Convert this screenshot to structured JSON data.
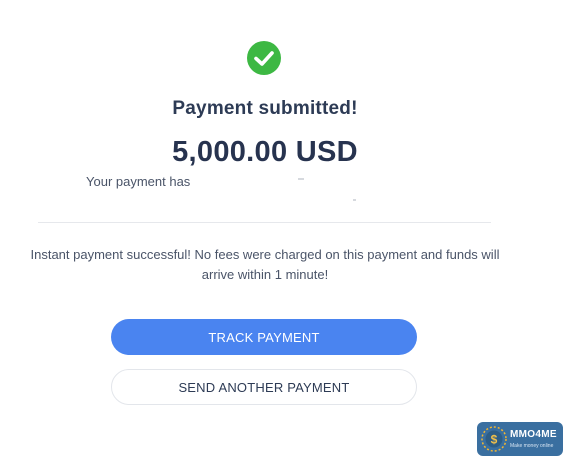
{
  "header": {
    "check_icon": "check-circle-icon",
    "title": "Payment submitted!",
    "amount": "5,000.00 USD",
    "status_text_partial": "Your payment has"
  },
  "info": {
    "message": "Instant payment successful! No fees were charged on this payment and funds will arrive within 1 minute!"
  },
  "actions": {
    "track_label": "TRACK PAYMENT",
    "send_another_label": "SEND ANOTHER PAYMENT"
  },
  "watermark": {
    "name": "MMO4ME",
    "tagline": "Make money online"
  },
  "colors": {
    "success_green": "#3db843",
    "primary_blue": "#4a84f0",
    "text_dark": "#2d3b55",
    "watermark_bg": "#3a6fa0"
  }
}
